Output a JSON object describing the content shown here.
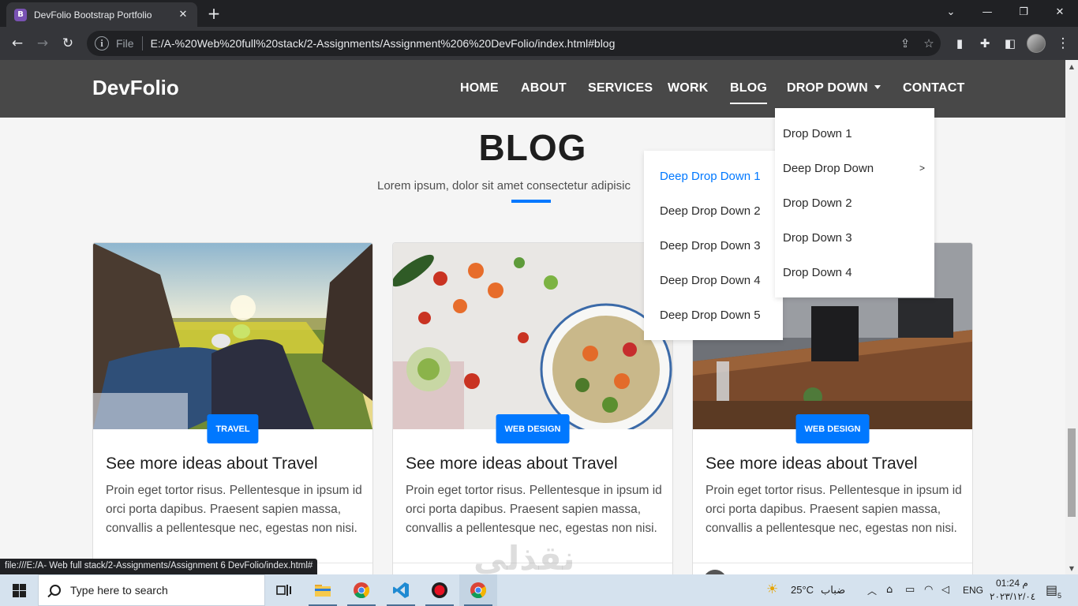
{
  "browser": {
    "tab_title": "DevFolio Bootstrap Portfolio",
    "tab_favicon": "B",
    "omnibox_prefix": "File",
    "url": "E:/A-%20Web%20full%20stack/2-Assignments/Assignment%206%20DevFolio/index.html#blog"
  },
  "site": {
    "brand": "DevFolio",
    "nav": [
      {
        "label": "HOME"
      },
      {
        "label": "ABOUT"
      },
      {
        "label": "SERVICES"
      },
      {
        "label": "WORK"
      },
      {
        "label": "BLOG",
        "active": true
      },
      {
        "label": "DROP DOWN"
      },
      {
        "label": "CONTACT"
      }
    ],
    "dropdown": [
      {
        "label": "Drop Down 1"
      },
      {
        "label": "Deep Drop Down",
        "arrow": ">"
      },
      {
        "label": "Drop Down 2"
      },
      {
        "label": "Drop Down 3"
      },
      {
        "label": "Drop Down 4"
      }
    ],
    "deep_dropdown": [
      {
        "label": "Deep Drop Down 1",
        "highlight": true
      },
      {
        "label": "Deep Drop Down 2"
      },
      {
        "label": "Deep Drop Down 3"
      },
      {
        "label": "Deep Drop Down 4"
      },
      {
        "label": "Deep Drop Down 5"
      }
    ],
    "blog": {
      "title": "BLOG",
      "subtitle": "Lorem ipsum, dolor sit amet consectetur adipisic"
    },
    "cards": [
      {
        "badge": "TRAVEL",
        "title": "See more ideas about Travel",
        "text": "Proin eget tortor risus. Pellentesque in ipsum id orci porta dapibus. Praesent sapien massa, convallis a pellentesque nec, egestas non nisi."
      },
      {
        "badge": "WEB DESIGN",
        "title": "See more ideas about Travel",
        "text": "Proin eget tortor risus. Pellentesque in ipsum id orci porta dapibus. Praesent sapien massa, convallis a pellentesque nec, egestas non nisi."
      },
      {
        "badge": "WEB DESIGN",
        "title": "See more ideas about Travel",
        "text": "Proin eget tortor risus. Pellentesque in ipsum id orci porta dapibus. Praesent sapien massa, convallis a pellentesque nec, egestas non nisi."
      }
    ]
  },
  "status_bar": "file:///E:/A- Web full stack/2-Assignments/Assignment 6 DevFolio/index.html#",
  "watermark": "نقذلي",
  "taskbar": {
    "search_placeholder": "Type here to search",
    "weather_temp": "25°C",
    "weather_desc": "ضباب",
    "language": "ENG",
    "time": "01:24 م",
    "date": "٢٠٢٣/١٢/٠٤",
    "notification_count": "5"
  },
  "colors": {
    "accent": "#0078ff",
    "nav_bg": "#484848"
  }
}
